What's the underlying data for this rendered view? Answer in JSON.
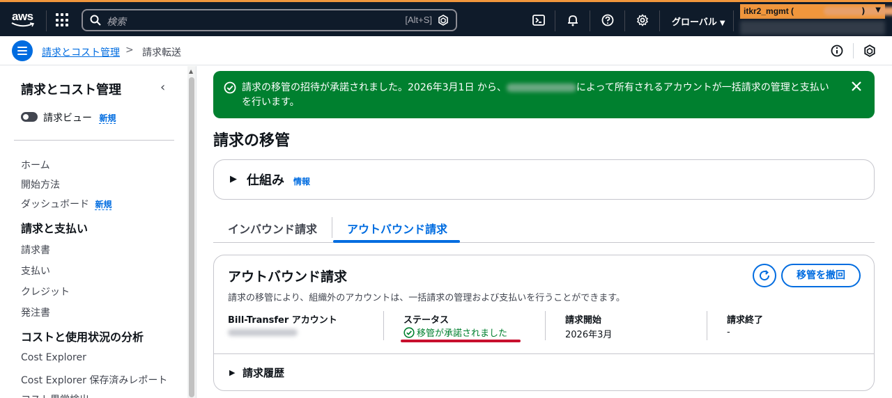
{
  "topnav": {
    "logo": "aws",
    "search_placeholder": "検索",
    "search_shortcut": "[Alt+S]",
    "region": "グローバル",
    "account_name": "itkr2_mgmt (",
    "account_paren": ")",
    "colors": {
      "bg": "#0f1b2a",
      "accent": "#f0963c"
    },
    "icons": [
      "grid-icon",
      "search-icon",
      "cloudshell-icon",
      "bell-icon",
      "help-icon",
      "gear-icon"
    ]
  },
  "breadcrumb": {
    "parent": "請求とコスト管理",
    "separator": ">",
    "current": "請求転送"
  },
  "sidebar": {
    "title": "請求とコスト管理",
    "toggle_label": "請求ビュー",
    "toggle_badge": "新規",
    "items": [
      {
        "label": "ホーム"
      },
      {
        "label": "開始方法"
      },
      {
        "label": "ダッシュボード",
        "badge": "新規"
      }
    ],
    "sections": [
      {
        "title": "請求と支払い",
        "items": [
          "請求書",
          "支払い",
          "クレジット",
          "発注書"
        ]
      },
      {
        "title": "コストと使用状況の分析",
        "items": [
          "Cost Explorer",
          "Cost Explorer 保存済みレポート",
          "コスト異常検出"
        ]
      }
    ]
  },
  "flash": {
    "msg_before": "請求の移管の招待が承諾されました。2026年3月1日 から、",
    "msg_after": "によって所有されるアカウントが一括請求の管理と支払い",
    "msg_line2": "を行います。",
    "color": "#00802f"
  },
  "main": {
    "title": "請求の移管",
    "expander_title": "仕組み",
    "expander_info": "情報",
    "tabs": [
      {
        "label": "インバウンド請求",
        "active": false
      },
      {
        "label": "アウトバウンド請求",
        "active": true
      }
    ]
  },
  "card": {
    "title": "アウトバウンド請求",
    "description": "請求の移管により、組織外のアカウントは、一括請求の管理および支払いを行うことができます。",
    "revoke_label": "移管を撤回",
    "fields": {
      "account_label": "Bill-Transfer アカウント",
      "status_label": "ステータス",
      "status_value": "移管が承諾されました",
      "start_label": "請求開始",
      "start_value": "2026年3月",
      "end_label": "請求終了",
      "end_value": "-"
    },
    "history_title": "請求履歴"
  }
}
